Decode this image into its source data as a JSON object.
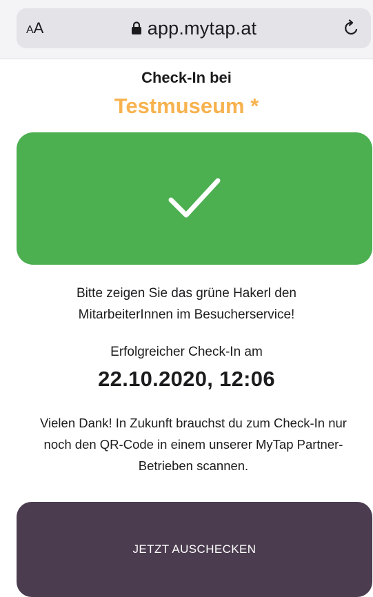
{
  "browser": {
    "reader_small": "A",
    "reader_large": "A",
    "url": "app.mytap.at"
  },
  "page": {
    "checkin_label": "Check-In bei",
    "venue_name": "Testmuseum *",
    "venue_color": "#f7b24f",
    "success_color": "#4caf50",
    "instruction_line1": "Bitte zeigen Sie das grüne Hakerl den",
    "instruction_line2": "MitarbeiterInnen im Besucherservice!",
    "success_label": "Erfolgreicher Check-In am",
    "timestamp": "22.10.2020, 12:06",
    "thanks_line1": "Vielen Dank! In Zukunft brauchst du zum Check-In nur",
    "thanks_line2": "noch den QR-Code in einem unserer MyTap Partner-",
    "thanks_line3": "Betrieben scannen.",
    "checkout_label": "JETZT AUSCHECKEN",
    "checkout_color": "#4b3c4f"
  },
  "icons": {
    "lock": "lock-icon",
    "reload": "reload-icon",
    "check": "checkmark-icon"
  }
}
